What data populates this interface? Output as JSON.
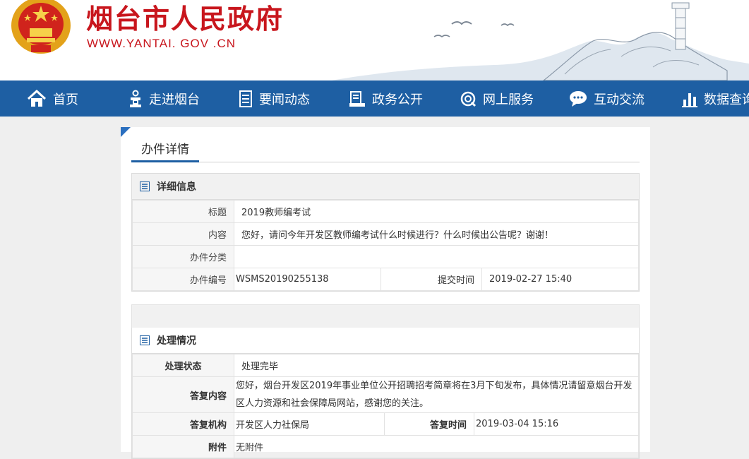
{
  "header": {
    "site_title": "烟台市人民政府",
    "site_url": "WWW.YANTAI. GOV .CN",
    "brand_color": "#c8161d"
  },
  "nav": {
    "bg_color": "#1e5fa3",
    "items": [
      {
        "label": "首页",
        "icon": "home-icon"
      },
      {
        "label": "走进烟台",
        "icon": "person-icon"
      },
      {
        "label": "要闻动态",
        "icon": "document-icon"
      },
      {
        "label": "政务公开",
        "icon": "clipboard-icon"
      },
      {
        "label": "网上服务",
        "icon": "globe-icon"
      },
      {
        "label": "互动交流",
        "icon": "chat-icon"
      },
      {
        "label": "数据查询",
        "icon": "bar-chart-icon"
      }
    ]
  },
  "page": {
    "tab_label": "办件详情"
  },
  "detail": {
    "section_title": "详细信息",
    "title_label": "标题",
    "title_value": "2019教师编考试",
    "content_label": "内容",
    "content_value": "您好，请问今年开发区教师编考试什么时候进行？什么时候出公告呢？谢谢！",
    "category_label": "办件分类",
    "category_value": "",
    "number_label": "办件编号",
    "number_value": "WSMS20190255138",
    "submit_time_label": "提交时间",
    "submit_time_value": "2019-02-27 15:40"
  },
  "processing": {
    "section_title": "处理情况",
    "status_label": "处理状态",
    "status_value": "处理完毕",
    "reply_label": "答复内容",
    "reply_value": "您好，烟台开发区2019年事业单位公开招聘招考简章将在3月下旬发布，具体情况请留意烟台开发区人力资源和社会保障局网站，感谢您的关注。",
    "org_label": "答复机构",
    "org_value": "开发区人力社保局",
    "reply_time_label": "答复时间",
    "reply_time_value": "2019-03-04 15:16",
    "attach_label": "附件",
    "attach_value": "无附件"
  }
}
